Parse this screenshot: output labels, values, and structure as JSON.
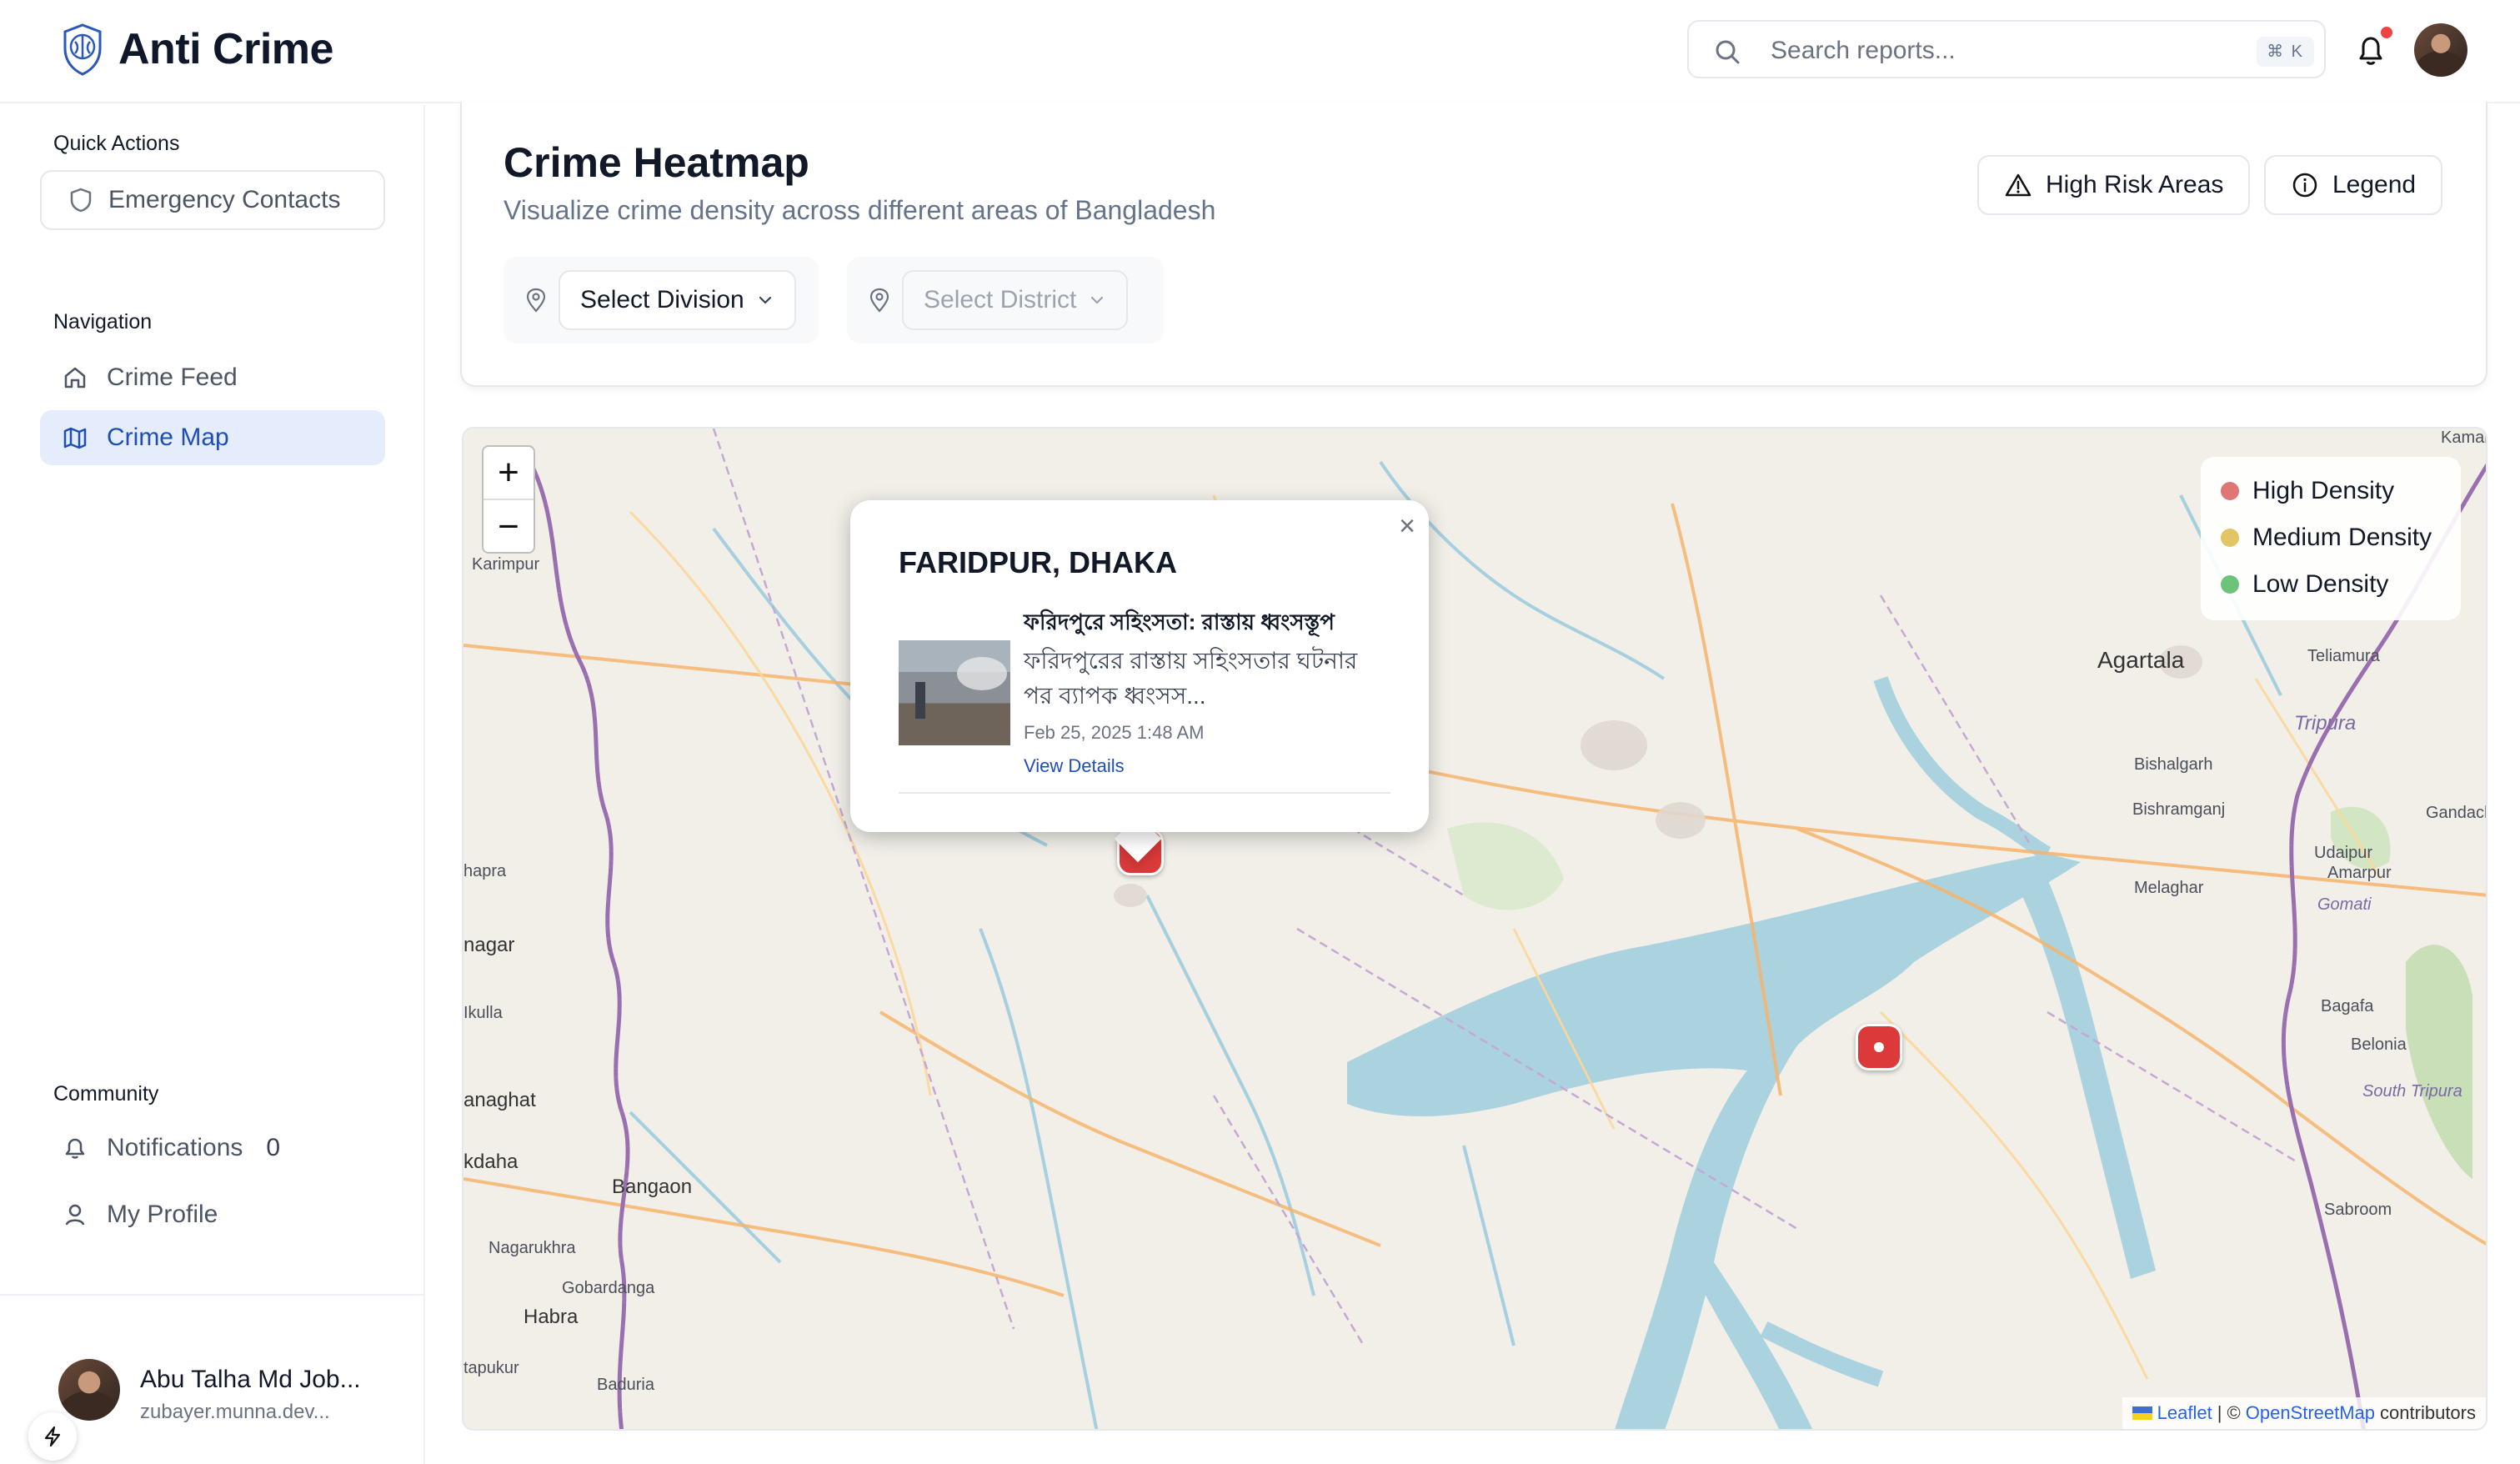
{
  "app": {
    "title": "Anti Crime"
  },
  "search": {
    "placeholder": "Search reports...",
    "shortcut": "⌘ K"
  },
  "sidebar": {
    "quick_actions_title": "Quick Actions",
    "emergency_label": "Emergency Contacts",
    "navigation_title": "Navigation",
    "nav": [
      {
        "label": "Crime Feed",
        "icon": "home-icon",
        "active": false
      },
      {
        "label": "Crime Map",
        "icon": "map-icon",
        "active": true
      }
    ],
    "community_title": "Community",
    "community": [
      {
        "label": "Notifications",
        "count": "0",
        "icon": "bell-icon"
      },
      {
        "label": "My Profile",
        "icon": "user-icon"
      }
    ],
    "user": {
      "name": "Abu Talha Md Job...",
      "email": "zubayer.munna.dev..."
    }
  },
  "page": {
    "title": "Crime Heatmap",
    "subtitle": "Visualize crime density across different areas of Bangladesh",
    "high_risk_label": "High Risk Areas",
    "legend_label": "Legend",
    "division_placeholder": "Select Division",
    "district_placeholder": "Select District"
  },
  "map": {
    "zoom_in": "+",
    "zoom_out": "−",
    "legend": [
      {
        "label": "High Density",
        "color": "#e07575"
      },
      {
        "label": "Medium Density",
        "color": "#e2c565"
      },
      {
        "label": "Low Density",
        "color": "#6cc47a"
      }
    ],
    "popup": {
      "location": "FARIDPUR, DHAKA",
      "headline": "ফরিদপুরে সহিংসতা: রাস্তায় ধ্বংসস্তূপ",
      "description": "ফরিদপুরের রাস্তায় সহিংসতার ঘটনার পর ব্যাপক ধ্বংসস...",
      "date": "Feb 25, 2025 1:48 AM",
      "link": "View Details",
      "close": "×"
    },
    "place_labels": [
      "Karimpur",
      "Agartala",
      "Teliamura",
      "Tripura",
      "Bishalgarh",
      "Bishramganj",
      "Udaipur",
      "Melaghar",
      "Amarpur",
      "Gomati",
      "Gandach",
      "Bagafa",
      "Belonia",
      "South Tripura",
      "Sabroom",
      "Bangaon",
      "Nagarukhra",
      "Gobardanga",
      "Habra",
      "Baduria",
      "tapukur",
      "kdaha",
      "anaghat",
      "Ikulla",
      "nagar",
      "hapra",
      "Kamalp"
    ],
    "attribution": {
      "leaflet": "Leaflet",
      "osm": "OpenStreetMap",
      "suffix": "contributors",
      "sep": "| ©"
    }
  },
  "colors": {
    "accent": "#1e4fb3",
    "marker": "#dc3a3a",
    "active_nav_bg": "#e5ecfb"
  }
}
